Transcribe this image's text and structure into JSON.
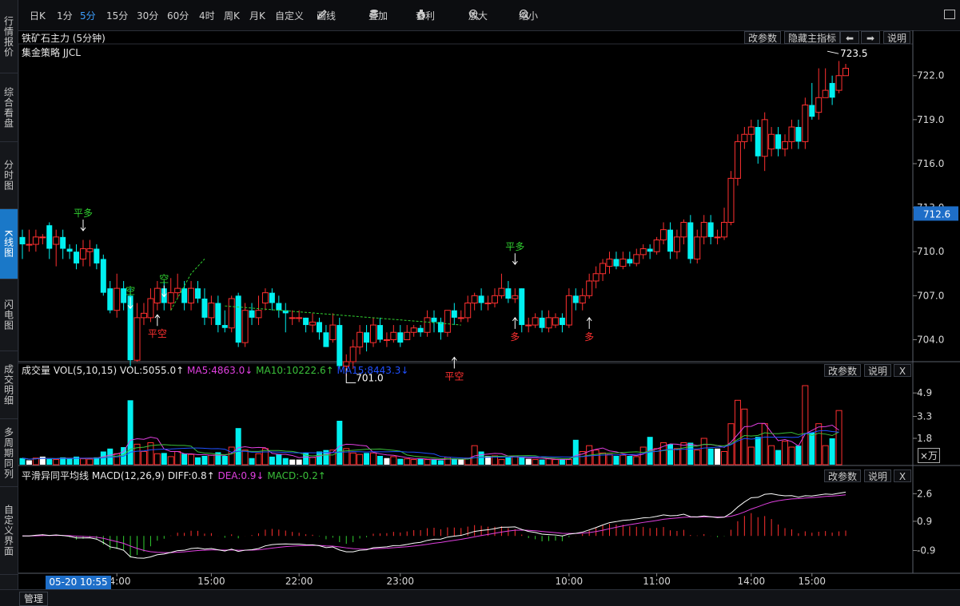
{
  "left_tabs": [
    {
      "label": "行情报价",
      "active": false
    },
    {
      "label": "综合看盘",
      "active": false
    },
    {
      "label": "分时图",
      "active": false
    },
    {
      "label": "K线图",
      "active": true
    },
    {
      "label": "闪电图",
      "active": false
    },
    {
      "label": "成交明细",
      "active": false
    },
    {
      "label": "多周期同列",
      "active": false
    },
    {
      "label": "自定义界面",
      "active": false
    }
  ],
  "toolbar": {
    "periods": [
      {
        "label": "日K",
        "selected": false
      },
      {
        "label": "1分",
        "selected": false
      },
      {
        "label": "5分",
        "selected": true
      },
      {
        "label": "15分",
        "selected": false
      },
      {
        "label": "30分",
        "selected": false
      },
      {
        "label": "60分",
        "selected": false
      },
      {
        "label": "4时",
        "selected": false
      },
      {
        "label": "周K",
        "selected": false
      },
      {
        "label": "月K",
        "selected": false
      },
      {
        "label": "自定义",
        "selected": false
      }
    ],
    "tools": [
      {
        "label": "画线",
        "icon": "pencil-icon"
      },
      {
        "label": "叠加",
        "icon": "stack-icon"
      },
      {
        "label": "套利",
        "icon": "moneybag-icon"
      },
      {
        "label": "放大",
        "icon": "zoom-in-icon"
      },
      {
        "label": "缩小",
        "icon": "zoom-out-icon"
      }
    ]
  },
  "main_panel": {
    "title": "铁矿石主力 (5分钟)",
    "strategy": "集金策略 JJCL",
    "buttons": {
      "params": "改参数",
      "hide_indicator": "隐藏主指标",
      "left": "⬅",
      "right": "➡",
      "help": "说明"
    },
    "price_ticks": [
      "722.0",
      "719.0",
      "716.0",
      "713.0",
      "710.0",
      "707.0",
      "704.0"
    ],
    "current_price": "712.6",
    "high_label": "723.5",
    "low_label": "701.0",
    "signals": [
      {
        "text": "平多",
        "color": "green"
      },
      {
        "text": "空",
        "color": "green"
      },
      {
        "text": "空",
        "color": "green"
      },
      {
        "text": "平空",
        "color": "red"
      },
      {
        "text": "平空",
        "color": "red"
      },
      {
        "text": "平多",
        "color": "green"
      },
      {
        "text": "多",
        "color": "red"
      },
      {
        "text": "多",
        "color": "red"
      }
    ]
  },
  "volume_panel": {
    "label": "成交量",
    "params": "VOL(5,10,15)",
    "vol": "VOL:5055.0↑",
    "ma5": "MA5:4863.0↓",
    "ma10": "MA10:10222.6↑",
    "ma15": "MA15:8443.3↓",
    "ticks": [
      "4.9",
      "3.3",
      "1.8"
    ],
    "unit": "×万",
    "buttons": {
      "params": "改参数",
      "help": "说明",
      "close": "X"
    },
    "colors": {
      "ma5": "#e040e0",
      "ma10": "#3ac03a",
      "ma15": "#2050ff"
    }
  },
  "macd_panel": {
    "label": "平滑异同平均线",
    "params": "MACD(12,26,9)",
    "diff": "DIFF:0.8↑",
    "dea": "DEA:0.9↓",
    "macd": "MACD:-0.2↑",
    "ticks": [
      "2.6",
      "0.9",
      "-0.9"
    ],
    "buttons": {
      "params": "改参数",
      "help": "说明",
      "close": "X"
    }
  },
  "time_axis": {
    "labels": [
      "14:00",
      "15:00",
      "22:00",
      "23:00",
      "10:00",
      "11:00",
      "14:00",
      "15:00"
    ],
    "current": "05-20 10:55"
  },
  "bottom": {
    "manage": "管理"
  },
  "colors": {
    "up": "#ff3030",
    "down": "#00f0f0",
    "bg": "#000000",
    "accent": "#1e6ec8"
  },
  "chart_data": {
    "type": "candlestick",
    "title": "铁矿石主力 (5分钟)",
    "ylim": [
      702.5,
      724
    ],
    "candles": [
      [
        711,
        710.5,
        711.5,
        709.5
      ],
      [
        710.5,
        710.5,
        711.5,
        710
      ],
      [
        710.5,
        711,
        711.5,
        710
      ],
      [
        711,
        711,
        711.2,
        710.5
      ],
      [
        711.8,
        710.2,
        712,
        709.5
      ],
      [
        710.5,
        711,
        711.5,
        709
      ],
      [
        711,
        710.2,
        711.5,
        709.5
      ],
      [
        710.2,
        710,
        710.5,
        709.5
      ],
      [
        710,
        709.2,
        710.5,
        708.8
      ],
      [
        709.5,
        710.2,
        710.8,
        709
      ],
      [
        710,
        710.2,
        710.8,
        709
      ],
      [
        710.2,
        709.2,
        710.5,
        708.8
      ],
      [
        709.5,
        707.2,
        709.8,
        707
      ],
      [
        707.5,
        706,
        708,
        705.8
      ],
      [
        706,
        707.5,
        708.5,
        705.5
      ],
      [
        707.5,
        706.5,
        708,
        706
      ],
      [
        707,
        702.6,
        707.5,
        702.2
      ],
      [
        702.6,
        705.5,
        706.5,
        702.5
      ],
      [
        705.5,
        705.8,
        706.5,
        705
      ],
      [
        705.5,
        706.8,
        707.5,
        705.2
      ],
      [
        706.5,
        707.5,
        708,
        706
      ],
      [
        707.5,
        706.5,
        708,
        706
      ],
      [
        706.5,
        707.2,
        708.2,
        706
      ],
      [
        707.2,
        707.5,
        708.5,
        706.8
      ],
      [
        707.5,
        706.5,
        708,
        706
      ],
      [
        706.5,
        707.5,
        708,
        706
      ],
      [
        707.5,
        706.8,
        708,
        706.5
      ],
      [
        706.8,
        705.5,
        707.5,
        705
      ],
      [
        705.5,
        706.5,
        707,
        705
      ],
      [
        706.5,
        705,
        707,
        704.5
      ],
      [
        705,
        704.8,
        706,
        704.5
      ],
      [
        704.8,
        706.8,
        707,
        704.5
      ],
      [
        707,
        703.8,
        707.2,
        703.5
      ],
      [
        703.8,
        706,
        706.5,
        703.5
      ],
      [
        706,
        705.5,
        706.5,
        705
      ],
      [
        705.5,
        706,
        707,
        705
      ],
      [
        706.5,
        707.2,
        707.5,
        706
      ],
      [
        707.2,
        706.5,
        707.5,
        706
      ],
      [
        706.5,
        706,
        707,
        705.5
      ],
      [
        706,
        705.8,
        706.5,
        704.5
      ],
      [
        705.5,
        705.5,
        706,
        705
      ],
      [
        705.5,
        705.5,
        706,
        705.2
      ],
      [
        705.5,
        705,
        705.5,
        704.5
      ],
      [
        705,
        705.2,
        705.8,
        704.5
      ],
      [
        705.2,
        704.5,
        705.5,
        704
      ],
      [
        704.5,
        703.5,
        705,
        703.5
      ],
      [
        704,
        705,
        705.8,
        703.8
      ],
      [
        705,
        702.2,
        705.5,
        702
      ],
      [
        702.2,
        702.5,
        703,
        701.5
      ],
      [
        702.5,
        703.5,
        704,
        702
      ],
      [
        703.5,
        704.5,
        705,
        703
      ],
      [
        704.5,
        703.8,
        705,
        703.2
      ],
      [
        703.8,
        705,
        705.5,
        703.5
      ],
      [
        705,
        704,
        705.5,
        703.8
      ],
      [
        704,
        704,
        704.5,
        703.5
      ],
      [
        704,
        704.5,
        705,
        703.8
      ],
      [
        704.5,
        703.8,
        705,
        703.5
      ],
      [
        704,
        704.5,
        705,
        704
      ],
      [
        704.5,
        704.8,
        705,
        704.2
      ],
      [
        704.8,
        704.5,
        705,
        704.2
      ],
      [
        704.5,
        705.5,
        706,
        704.2
      ],
      [
        705.5,
        705.2,
        706,
        704.5
      ],
      [
        705.2,
        704.5,
        705.5,
        704
      ],
      [
        704.5,
        706,
        706,
        704.2
      ],
      [
        706,
        705.5,
        706.5,
        705
      ],
      [
        705.5,
        705.5,
        706,
        705.2
      ],
      [
        705.5,
        706.5,
        707,
        705.2
      ],
      [
        706.5,
        707,
        707.2,
        706
      ],
      [
        707,
        706.5,
        707.5,
        706
      ],
      [
        706.5,
        706.5,
        707,
        706
      ],
      [
        706.5,
        707,
        707.5,
        706.2
      ],
      [
        707,
        707.5,
        708.5,
        706.8
      ],
      [
        707.5,
        706.8,
        708,
        706.5
      ],
      [
        706.8,
        707,
        707.5,
        706.5
      ],
      [
        707.5,
        705,
        707.5,
        704.5
      ],
      [
        705,
        705,
        705.5,
        704.5
      ],
      [
        705,
        705.5,
        705.8,
        704.8
      ],
      [
        705.5,
        704.8,
        706,
        704.5
      ],
      [
        704.8,
        705.5,
        706,
        704.5
      ],
      [
        705,
        705.5,
        705.8,
        704.8
      ],
      [
        705.5,
        705,
        705.8,
        704.5
      ],
      [
        705,
        707,
        707.5,
        704.8
      ],
      [
        707,
        706.5,
        707.5,
        706
      ],
      [
        706.5,
        707,
        707.5,
        706
      ],
      [
        707,
        708,
        708.5,
        706.8
      ],
      [
        708,
        708.5,
        709,
        707.5
      ],
      [
        708.5,
        709.2,
        709.5,
        708
      ],
      [
        709,
        709.5,
        710,
        708.5
      ],
      [
        709.5,
        709,
        710,
        708.8
      ],
      [
        709,
        709.5,
        710,
        708.8
      ],
      [
        709.5,
        709.2,
        710,
        709
      ],
      [
        709.2,
        709.8,
        710.2,
        709
      ],
      [
        709.8,
        710.2,
        710.5,
        709.5
      ],
      [
        710.2,
        710,
        710.5,
        709.5
      ],
      [
        710,
        710.8,
        711,
        709.8
      ],
      [
        710.8,
        711.5,
        712,
        710.5
      ],
      [
        711.5,
        710,
        712,
        709.5
      ],
      [
        710,
        711,
        711.5,
        709.5
      ],
      [
        711,
        712,
        712.2,
        710.5
      ],
      [
        712,
        709.5,
        712.5,
        709.2
      ],
      [
        709.5,
        711,
        711.5,
        709.2
      ],
      [
        711,
        712,
        712.5,
        710.5
      ],
      [
        712,
        711,
        712.5,
        710.5
      ],
      [
        711,
        711,
        711.5,
        710.5
      ],
      [
        711,
        712,
        713,
        710.8
      ],
      [
        712,
        715,
        715.5,
        711.8
      ],
      [
        715,
        717.5,
        718,
        714.5
      ],
      [
        717.5,
        718,
        718.5,
        717
      ],
      [
        718,
        718.5,
        719,
        717.5
      ],
      [
        718.5,
        716.5,
        719,
        716
      ],
      [
        716.5,
        719,
        719.5,
        715.5
      ],
      [
        717,
        718,
        718.5,
        716.5
      ],
      [
        718,
        717,
        718.5,
        716.5
      ],
      [
        717,
        717.5,
        718,
        716.5
      ],
      [
        717.5,
        718.5,
        719,
        717
      ],
      [
        718.5,
        717.5,
        719,
        717
      ],
      [
        717.5,
        720,
        720.5,
        717
      ],
      [
        720,
        719.2,
        721.5,
        719
      ],
      [
        719.5,
        720.5,
        722.5,
        719
      ],
      [
        720.5,
        721,
        722.5,
        720.5
      ],
      [
        721.5,
        720.5,
        722,
        720
      ],
      [
        721,
        722,
        723,
        720.8
      ],
      [
        722,
        722.5,
        722.8,
        722
      ]
    ],
    "volume": [
      0.45,
      0.3,
      0.45,
      0.55,
      0.38,
      0.35,
      0.5,
      0.42,
      0.55,
      0.4,
      0.38,
      0.5,
      0.9,
      1.1,
      0.75,
      1.2,
      4.4,
      1.4,
      0.9,
      1.5,
      0.75,
      0.8,
      0.55,
      0.9,
      0.75,
      0.7,
      0.5,
      0.6,
      0.65,
      0.85,
      0.6,
      1.2,
      2.5,
      1.0,
      0.45,
      0.75,
      1.1,
      0.55,
      0.7,
      0.45,
      0.35,
      0.35,
      0.8,
      0.5,
      0.9,
      1.0,
      1.0,
      3.0,
      1.1,
      0.8,
      0.7,
      0.8,
      0.8,
      0.6,
      0.45,
      0.55,
      0.4,
      0.4,
      0.35,
      0.4,
      0.35,
      0.35,
      0.3,
      0.5,
      0.4,
      0.35,
      0.45,
      1.3,
      0.9,
      0.6,
      0.6,
      0.35,
      0.5,
      0.6,
      0.5,
      0.4,
      0.35,
      0.35,
      0.4,
      0.35,
      0.35,
      0.35,
      1.7,
      0.9,
      1.3,
      1.0,
      0.8,
      0.7,
      0.6,
      0.65,
      0.6,
      0.55,
      1.2,
      1.9,
      1.1,
      1.5,
      1.4,
      1.1,
      1.5,
      1.5,
      1.0,
      1.8,
      1.1,
      1.1,
      0.9,
      2.8,
      4.4,
      3.8,
      1.2,
      1.9,
      2.8,
      1.3,
      1.0,
      1.6,
      1.2,
      1.3,
      5.4,
      2.2,
      2.8,
      1.3,
      1.8,
      3.7
    ],
    "volume_unit": "万",
    "volume_ylim": [
      0,
      6
    ],
    "macd": {
      "diff_last": 0.8,
      "dea_last": 0.9,
      "macd_last": -0.2,
      "ylim": [
        -2.2,
        3.5
      ]
    },
    "x_labels": [
      "14:00",
      "15:00",
      "22:00",
      "23:00",
      "10:00",
      "11:00",
      "14:00",
      "15:00"
    ]
  }
}
